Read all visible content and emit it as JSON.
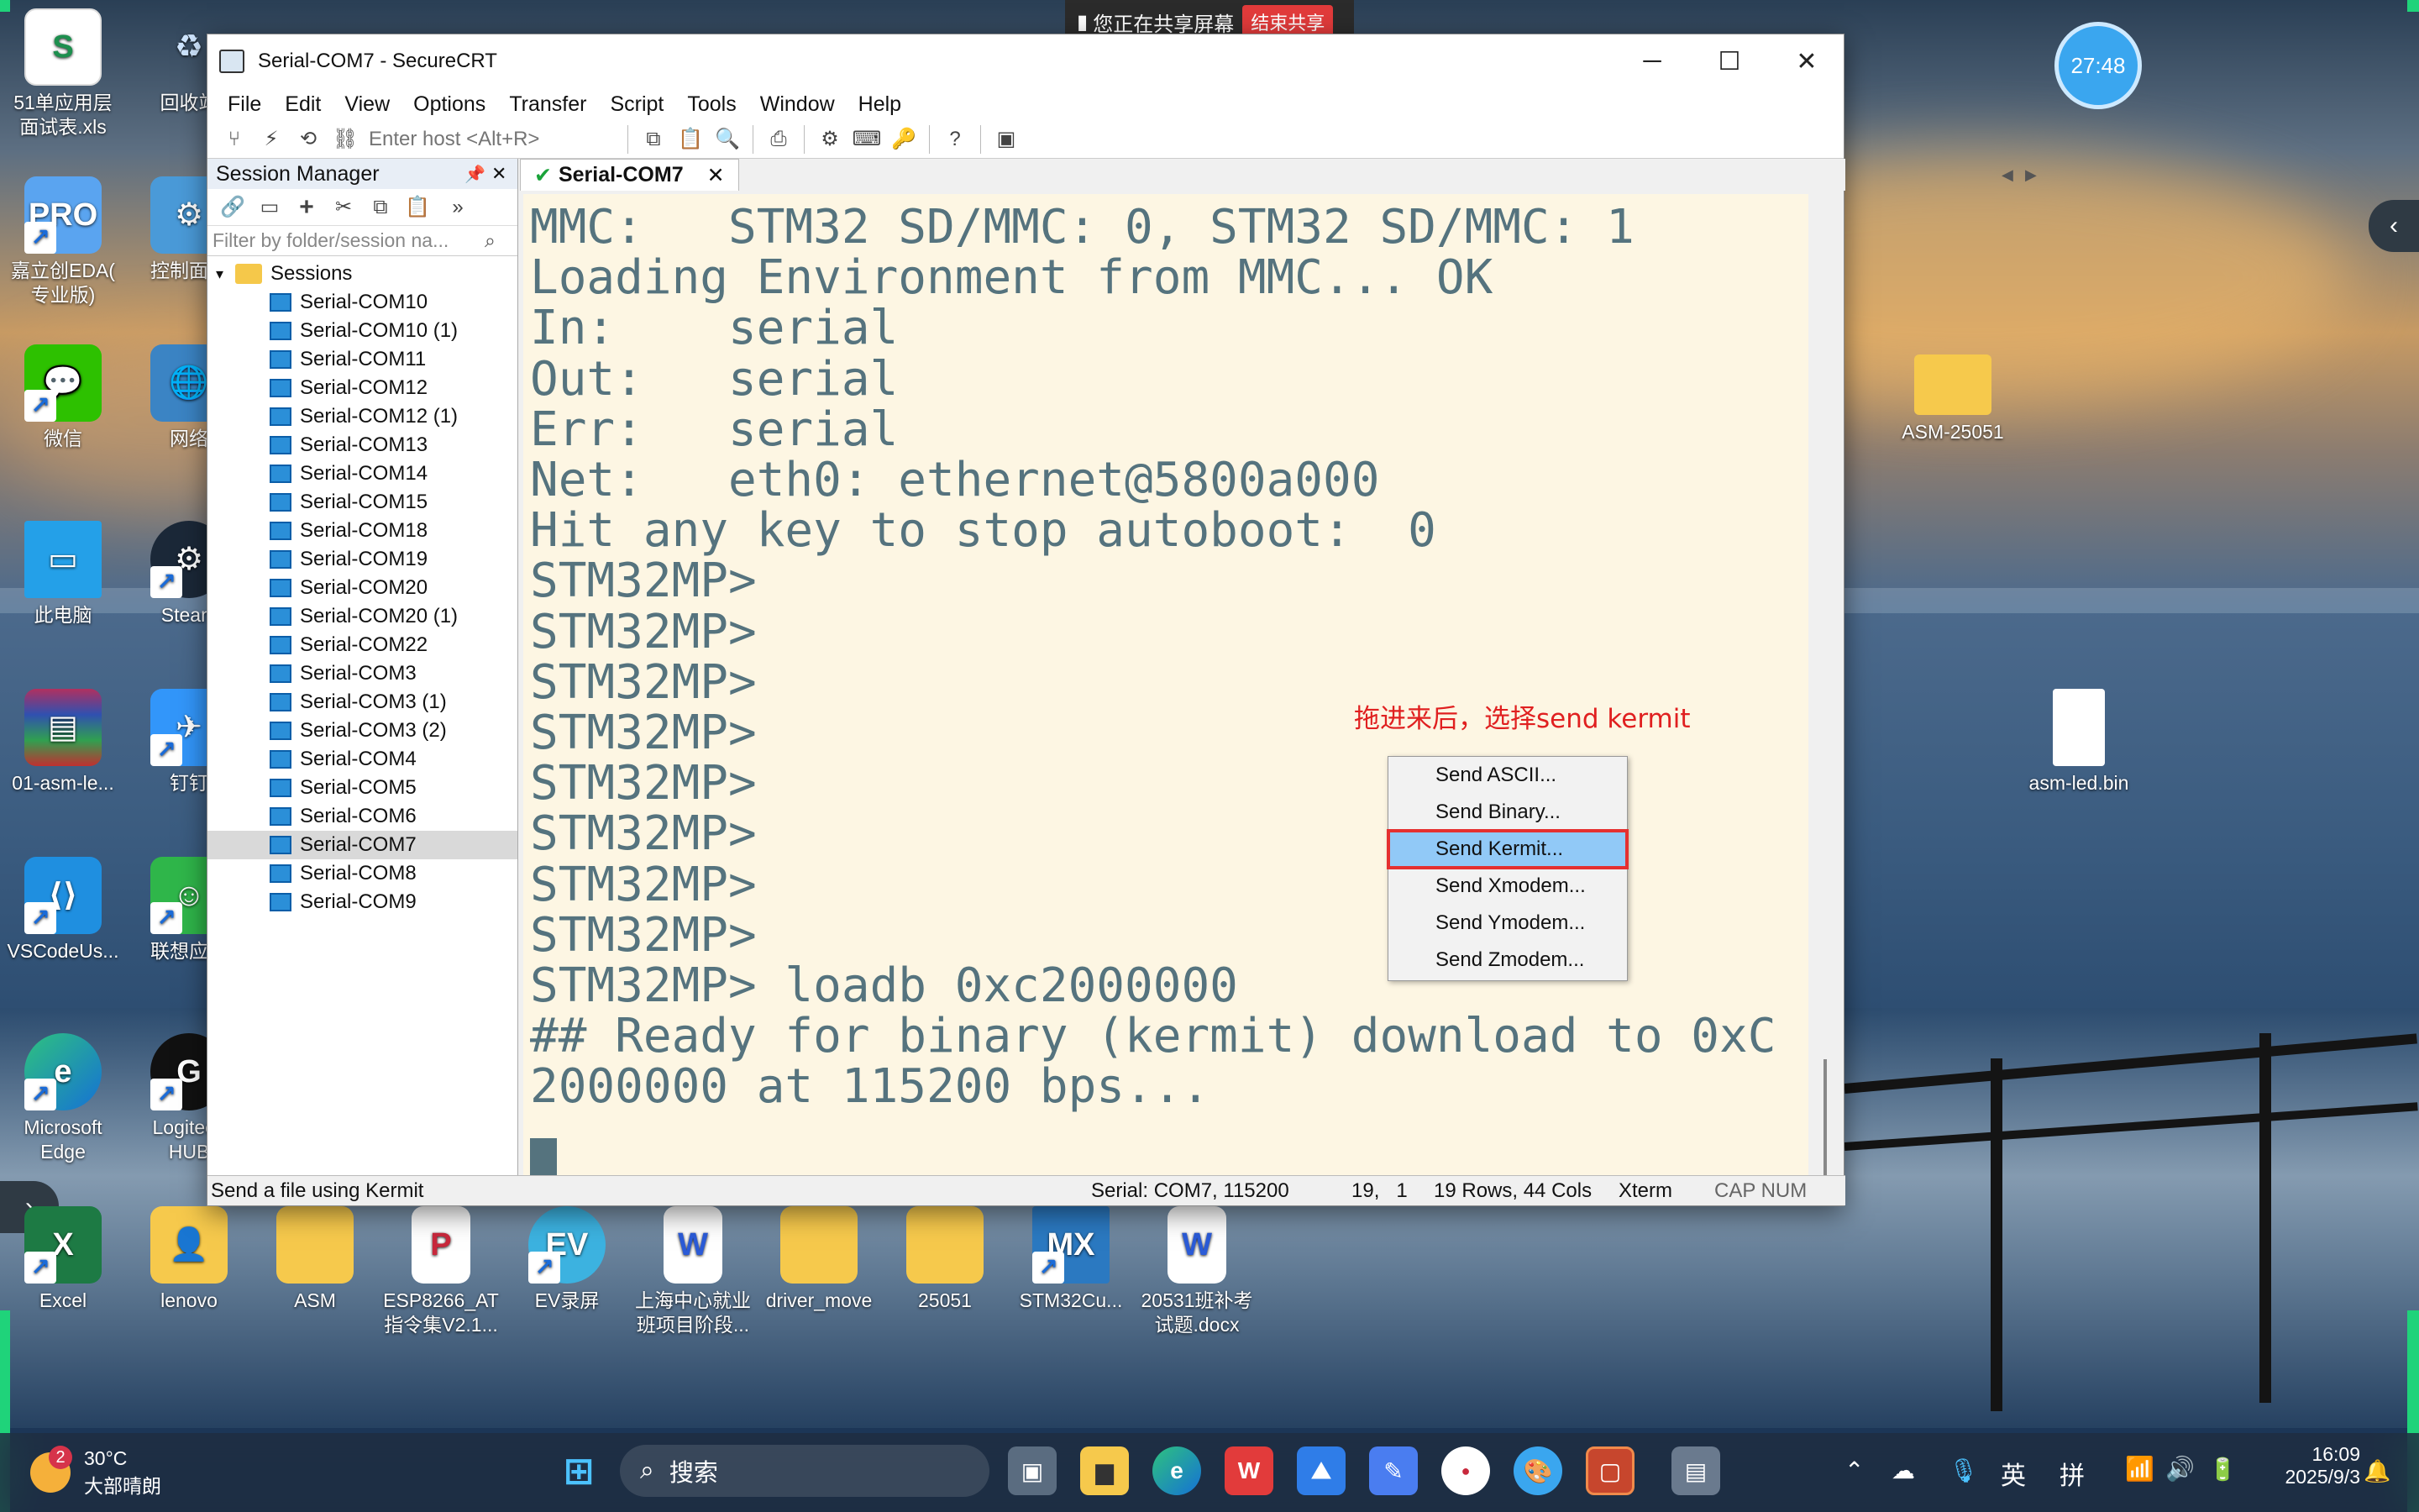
{
  "sharing_bar": {
    "text": "您正在共享屏幕",
    "stop": "结束共享"
  },
  "timer": "27:48",
  "desktop_left": [
    {
      "label": "51单应用层\n面试表.xls",
      "icon": "spreadsheet-icon"
    },
    {
      "label": "回收站",
      "icon": "recycle-bin-icon"
    },
    {
      "label": "嘉立创EDA(\n专业版)",
      "icon": "cloud-pro-icon"
    },
    {
      "label": "控制面板",
      "icon": "control-panel-icon"
    },
    {
      "label": "微信",
      "icon": "wechat-icon"
    },
    {
      "label": "网络",
      "icon": "network-icon"
    },
    {
      "label": "此电脑",
      "icon": "computer-icon"
    },
    {
      "label": "Steam",
      "icon": "steam-icon"
    },
    {
      "label": "01-asm-le...",
      "icon": "winrar-icon"
    },
    {
      "label": "钉钉",
      "icon": "dingtalk-icon"
    },
    {
      "label": "VSCodeUs...",
      "icon": "vscode-icon"
    },
    {
      "label": "联想应用",
      "icon": "lenovo-app-icon"
    },
    {
      "label": "Microsoft\nEdge",
      "icon": "edge-icon"
    },
    {
      "label": "Logitech\nHUB",
      "icon": "logitech-icon"
    }
  ],
  "desktop_right": [
    {
      "label": "ASM-25051",
      "icon": "folder-icon"
    },
    {
      "label": "asm-led.bin",
      "icon": "file-icon"
    }
  ],
  "desktop_bottom": [
    {
      "label": "Excel"
    },
    {
      "label": "lenovo"
    },
    {
      "label": "ASM"
    },
    {
      "label": "ESP8266_AT\n指令集V2.1..."
    },
    {
      "label": "EV录屏"
    },
    {
      "label": "上海中心就业\n班项目阶段..."
    },
    {
      "label": "driver_move"
    },
    {
      "label": "25051"
    },
    {
      "label": "STM32Cu..."
    },
    {
      "label": "20531班补考\n试题.docx"
    }
  ],
  "window": {
    "title": "Serial-COM7 - SecureCRT",
    "menu": [
      "File",
      "Edit",
      "View",
      "Options",
      "Transfer",
      "Script",
      "Tools",
      "Window",
      "Help"
    ],
    "host_placeholder": "Enter host <Alt+R>",
    "session_manager": {
      "title": "Session Manager",
      "filter_placeholder": "Filter by folder/session na...",
      "root": "Sessions",
      "sessions": [
        "Serial-COM10",
        "Serial-COM10 (1)",
        "Serial-COM11",
        "Serial-COM12",
        "Serial-COM12 (1)",
        "Serial-COM13",
        "Serial-COM14",
        "Serial-COM15",
        "Serial-COM18",
        "Serial-COM19",
        "Serial-COM20",
        "Serial-COM20 (1)",
        "Serial-COM22",
        "Serial-COM3",
        "Serial-COM3 (1)",
        "Serial-COM3 (2)",
        "Serial-COM4",
        "Serial-COM5",
        "Serial-COM6",
        "Serial-COM7",
        "Serial-COM8",
        "Serial-COM9"
      ],
      "selected": "Serial-COM7"
    },
    "tab": "Serial-COM7",
    "terminal_lines": [
      "MMC:   STM32 SD/MMC: 0, STM32 SD/MMC: 1",
      "Loading Environment from MMC... OK",
      "In:    serial",
      "Out:   serial",
      "Err:   serial",
      "Net:   eth0: ethernet@5800a000",
      "Hit any key to stop autoboot:  0",
      "STM32MP>",
      "STM32MP>",
      "STM32MP>",
      "STM32MP>",
      "STM32MP>",
      "STM32MP>",
      "STM32MP>",
      "STM32MP>",
      "STM32MP> loadb 0xc2000000",
      "## Ready for binary (kermit) download to 0xC",
      "2000000 at 115200 bps..."
    ],
    "status": {
      "hint": "Send a file using Kermit",
      "conn": "Serial: COM7, 115200",
      "pos": "19,   1",
      "size": "19 Rows, 44 Cols",
      "term": "Xterm",
      "keys": "CAP NUM"
    }
  },
  "annotation": "拖进来后，选择send kermit",
  "context_menu": [
    "Send ASCII...",
    "Send Binary...",
    "Send Kermit...",
    "Send Xmodem...",
    "Send Ymodem...",
    "Send Zmodem..."
  ],
  "context_menu_selected": "Send Kermit...",
  "taskbar": {
    "weather_temp": "30°C",
    "weather_desc": "大部晴朗",
    "weather_badge": "2",
    "search": "搜索",
    "ime1": "英",
    "ime2": "拼",
    "time": "16:09",
    "date": "2025/9/3"
  }
}
